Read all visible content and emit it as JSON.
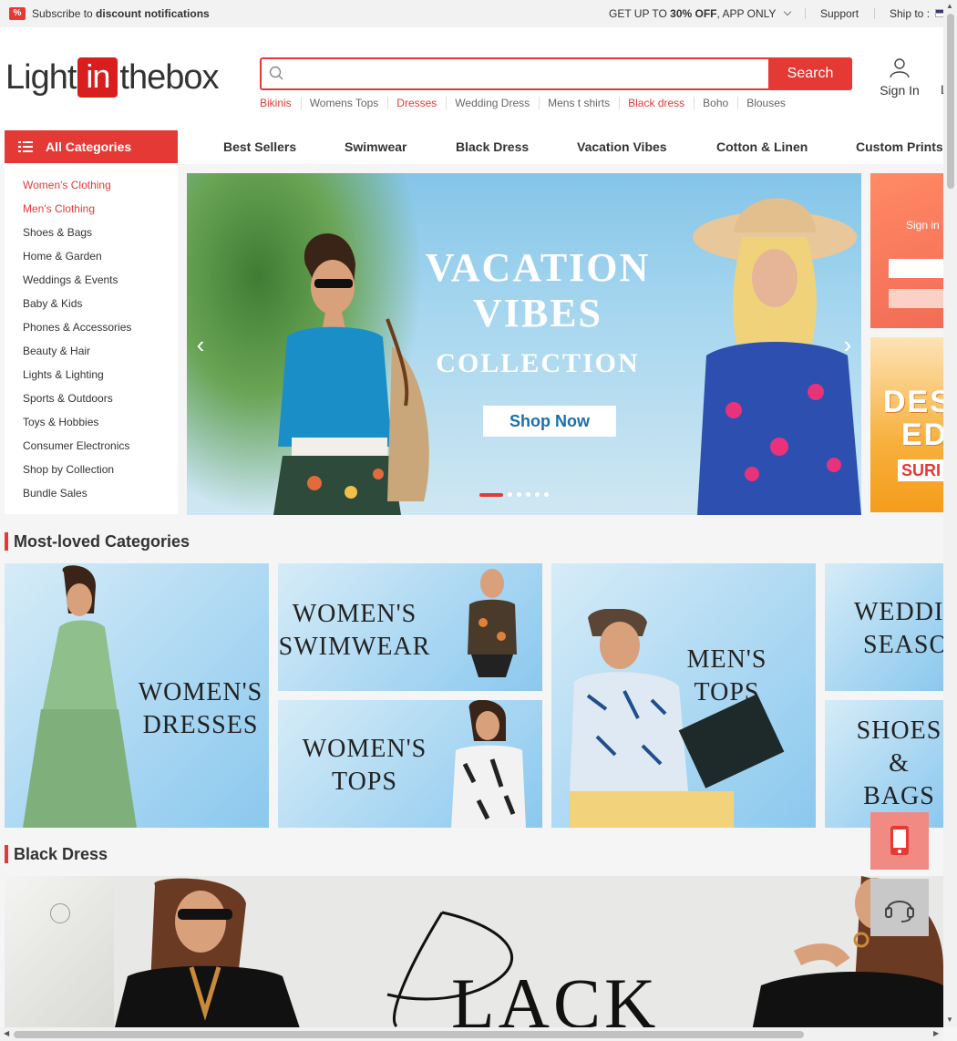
{
  "topbar": {
    "subscribe_prefix": "Subscribe to",
    "subscribe_bold": "discount notifications",
    "app_offer_prefix": "GET UP TO",
    "app_offer_bold": "30% OFF",
    "app_offer_suffix": ", APP ONLY",
    "support": "Support",
    "ship_to": "Ship to :"
  },
  "header": {
    "logo_left": "Light",
    "logo_in": "in",
    "logo_right": "thebox",
    "search_placeholder": "",
    "search_button": "Search",
    "hot_words": [
      {
        "label": "Bikinis",
        "highlight": true
      },
      {
        "label": "Womens Tops",
        "highlight": false
      },
      {
        "label": "Dresses",
        "highlight": true
      },
      {
        "label": "Wedding Dress",
        "highlight": false
      },
      {
        "label": "Mens t shirts",
        "highlight": false
      },
      {
        "label": "Black dress",
        "highlight": true
      },
      {
        "label": "Boho",
        "highlight": false
      },
      {
        "label": "Blouses",
        "highlight": false
      }
    ],
    "sign_in": "Sign In",
    "cut_label": "L"
  },
  "nav": {
    "all_categories": "All Categories",
    "items": [
      "Best Sellers",
      "Swimwear",
      "Black Dress",
      "Vacation Vibes",
      "Cotton & Linen",
      "Custom Prints"
    ]
  },
  "sidemenu": {
    "items": [
      {
        "label": "Women's Clothing",
        "highlight": true
      },
      {
        "label": "Men's Clothing",
        "highlight": true
      },
      {
        "label": "Shoes & Bags",
        "highlight": false
      },
      {
        "label": "Home & Garden",
        "highlight": false
      },
      {
        "label": "Weddings & Events",
        "highlight": false
      },
      {
        "label": "Baby & Kids",
        "highlight": false
      },
      {
        "label": "Phones & Accessories",
        "highlight": false
      },
      {
        "label": "Beauty & Hair",
        "highlight": false
      },
      {
        "label": "Lights & Lighting",
        "highlight": false
      },
      {
        "label": "Sports & Outdoors",
        "highlight": false
      },
      {
        "label": "Toys & Hobbies",
        "highlight": false
      },
      {
        "label": "Consumer Electronics",
        "highlight": false
      },
      {
        "label": "Shop by Collection",
        "highlight": false
      },
      {
        "label": "Bundle Sales",
        "highlight": false
      }
    ]
  },
  "banner": {
    "title_line1": "VACATION",
    "title_line2": "VIBES",
    "title_line3": "COLLECTION",
    "cta": "Shop Now",
    "slide_count": 6,
    "active_slide": 1
  },
  "signin_card": {
    "text": "Sign in"
  },
  "promo_card": {
    "line1": "DES",
    "line2": "ED",
    "line3": "SURI"
  },
  "most_loved": {
    "title": "Most-loved Categories",
    "tiles": {
      "womens_dresses": [
        "WOMEN'S",
        "DRESSES"
      ],
      "womens_swimwear": [
        "WOMEN'S",
        "SWIMWEAR"
      ],
      "womens_tops": [
        "WOMEN'S",
        "TOPS"
      ],
      "mens_tops": [
        "MEN'S",
        "TOPS"
      ],
      "wedding_season": [
        "WEDDIN",
        "SEASO"
      ],
      "shoes_bags": [
        "SHOES",
        "&",
        "BAGS"
      ]
    }
  },
  "black_dress": {
    "title": "Black Dress",
    "banner_text": "LACK"
  },
  "colors": {
    "accent": "#e53935",
    "text": "#333333",
    "page_bg": "#f5f5f5"
  }
}
